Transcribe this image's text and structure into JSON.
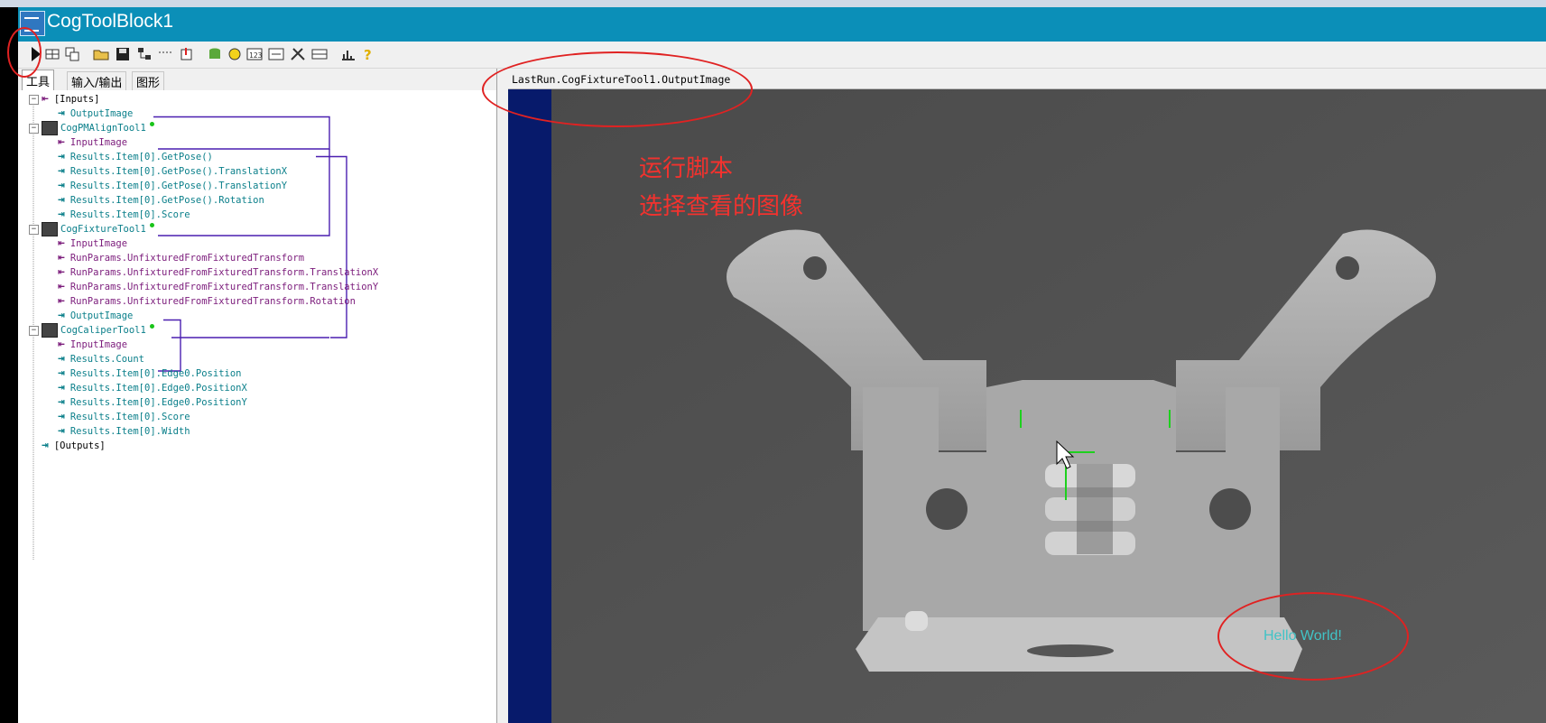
{
  "window": {
    "title": "CogToolBlock1"
  },
  "toolbar": {
    "buttons": [
      {
        "icon": "run-icon"
      },
      {
        "icon": "grid-icon"
      },
      {
        "icon": "copy-icon"
      },
      {
        "icon": "open-folder-icon"
      },
      {
        "icon": "save-icon"
      },
      {
        "icon": "tree-icon"
      },
      {
        "icon": "dash-icon"
      },
      {
        "icon": "import-icon"
      },
      {
        "icon": "database-icon"
      },
      {
        "icon": "refresh-icon"
      },
      {
        "icon": "counter-icon"
      },
      {
        "icon": "edit-icon"
      },
      {
        "icon": "tools-icon"
      },
      {
        "icon": "table-icon"
      },
      {
        "icon": "chart-icon"
      },
      {
        "icon": "help-icon"
      }
    ]
  },
  "tabs": [
    {
      "label": "工具",
      "active": true
    },
    {
      "label": "输入/输出",
      "active": false
    },
    {
      "label": "图形",
      "active": false
    }
  ],
  "tree": [
    {
      "text": "[Inputs]",
      "kind": "group"
    },
    {
      "text": "OutputImage",
      "kind": "out"
    },
    {
      "text": "CogPMAlignTool1",
      "kind": "tool"
    },
    {
      "text": "InputImage",
      "kind": "in"
    },
    {
      "text": "Results.Item[0].GetPose()",
      "kind": "out"
    },
    {
      "text": "Results.Item[0].GetPose().TranslationX",
      "kind": "out"
    },
    {
      "text": "Results.Item[0].GetPose().TranslationY",
      "kind": "out"
    },
    {
      "text": "Results.Item[0].GetPose().Rotation",
      "kind": "out"
    },
    {
      "text": "Results.Item[0].Score",
      "kind": "out"
    },
    {
      "text": "CogFixtureTool1",
      "kind": "tool"
    },
    {
      "text": "InputImage",
      "kind": "in"
    },
    {
      "text": "RunParams.UnfixturedFromFixturedTransform",
      "kind": "in"
    },
    {
      "text": "RunParams.UnfixturedFromFixturedTransform.TranslationX",
      "kind": "in"
    },
    {
      "text": "RunParams.UnfixturedFromFixturedTransform.TranslationY",
      "kind": "in"
    },
    {
      "text": "RunParams.UnfixturedFromFixturedTransform.Rotation",
      "kind": "in"
    },
    {
      "text": "OutputImage",
      "kind": "out"
    },
    {
      "text": "CogCaliperTool1",
      "kind": "tool"
    },
    {
      "text": "InputImage",
      "kind": "in"
    },
    {
      "text": "Results.Count",
      "kind": "out"
    },
    {
      "text": "Results.Item[0].Edge0.Position",
      "kind": "out"
    },
    {
      "text": "Results.Item[0].Edge0.PositionX",
      "kind": "out"
    },
    {
      "text": "Results.Item[0].Edge0.PositionY",
      "kind": "out"
    },
    {
      "text": "Results.Item[0].Score",
      "kind": "out"
    },
    {
      "text": "Results.Item[0].Width",
      "kind": "out"
    },
    {
      "text": "[Outputs]",
      "kind": "group"
    }
  ],
  "image_view": {
    "path": "LastRun.CogFixtureTool1.OutputImage",
    "annotation_line1": "运行脚本",
    "annotation_line2": "选择查看的图像",
    "overlay_text": "Hello World!"
  },
  "colors": {
    "titlebar": "#0b8fb8",
    "annotation_red": "#f3322e",
    "overlay_cyan": "#41c3c6",
    "link_line": "#4a1fb0"
  }
}
